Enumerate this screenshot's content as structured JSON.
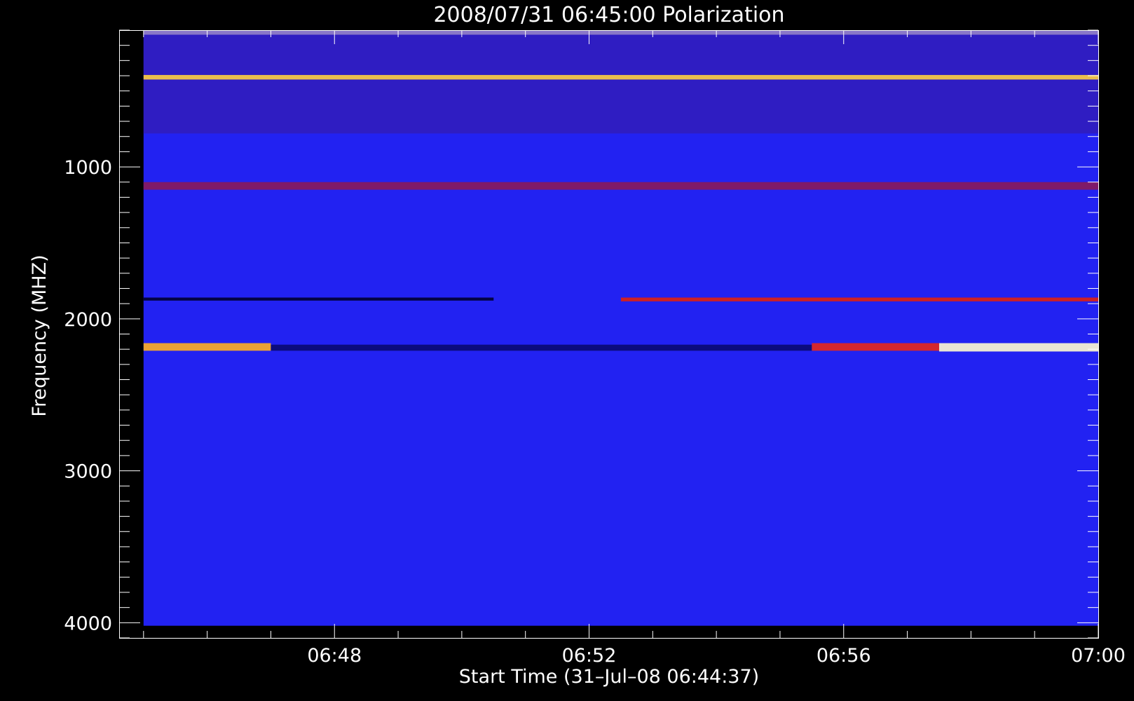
{
  "chart_data": {
    "type": "heatmap",
    "title": "2008/07/31 06:45:00 Polarization",
    "xlabel": "Start Time (31–Jul–08 06:44:37)",
    "ylabel": "Frequency (MHZ)",
    "x_range": [
      "06:44:37",
      "07:00:00"
    ],
    "x_data_range": [
      "06:45:00",
      "07:00:00"
    ],
    "x_ticks": [
      "06:48",
      "06:52",
      "06:56",
      "07:00"
    ],
    "y_range": [
      100,
      4100
    ],
    "y_data_range": [
      100,
      4020
    ],
    "y_inverted": true,
    "y_ticks": [
      1000,
      2000,
      3000,
      4000
    ],
    "background_color": "#000000",
    "colormap": [
      "#000000",
      "#1a0f9a",
      "#2222f2",
      "#d10808",
      "#ffff60",
      "#ffffff"
    ],
    "features": [
      {
        "kind": "band",
        "freq_mhz": [
          100,
          130
        ],
        "time": [
          "06:45:00",
          "07:00:00"
        ],
        "color": "#ffffff"
      },
      {
        "kind": "band",
        "freq_mhz": [
          100,
          780
        ],
        "time": [
          "06:45:00",
          "07:00:00"
        ],
        "color": "#3a1a9a"
      },
      {
        "kind": "band",
        "freq_mhz": [
          395,
          425
        ],
        "time": [
          "06:45:00",
          "07:00:00"
        ],
        "color": "#ffd040"
      },
      {
        "kind": "band",
        "freq_mhz": [
          1100,
          1150
        ],
        "time": [
          "06:45:00",
          "07:00:00"
        ],
        "color": "#8a1a5a"
      },
      {
        "kind": "band",
        "freq_mhz": [
          1860,
          1880
        ],
        "time": [
          "06:45:00",
          "06:50:30"
        ],
        "color": "#000030"
      },
      {
        "kind": "band",
        "freq_mhz": [
          1860,
          1885
        ],
        "time": [
          "06:52:30",
          "07:00:00"
        ],
        "color": "#e02010"
      },
      {
        "kind": "band",
        "freq_mhz": [
          2160,
          2210
        ],
        "time": [
          "06:45:00",
          "06:47:00"
        ],
        "color": "#ffb020"
      },
      {
        "kind": "band",
        "freq_mhz": [
          2170,
          2210
        ],
        "time": [
          "06:47:00",
          "06:55:30"
        ],
        "color": "#0a0a70"
      },
      {
        "kind": "band",
        "freq_mhz": [
          2160,
          2210
        ],
        "time": [
          "06:55:30",
          "06:57:30"
        ],
        "color": "#e82818"
      },
      {
        "kind": "band",
        "freq_mhz": [
          2160,
          2215
        ],
        "time": [
          "06:57:30",
          "07:00:00"
        ],
        "color": "#fffbd0"
      }
    ]
  }
}
